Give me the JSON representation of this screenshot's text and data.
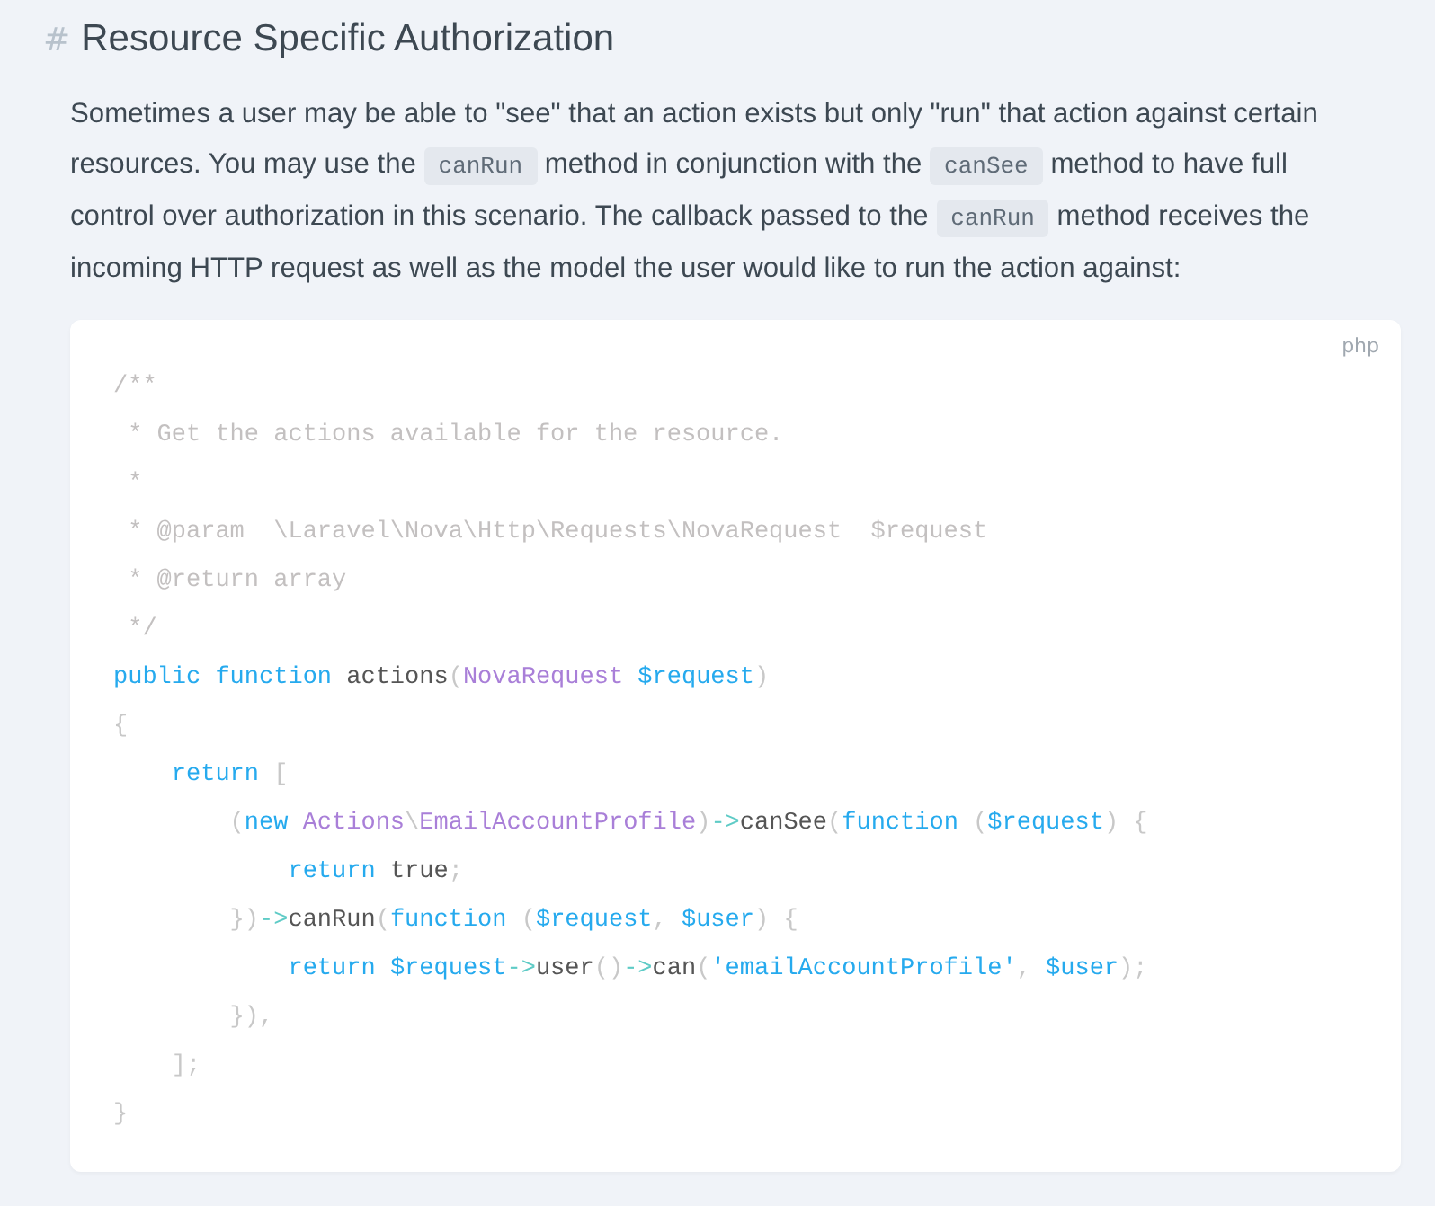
{
  "heading": {
    "mark": "#",
    "title": "Resource Specific Authorization"
  },
  "paragraph": [
    {
      "kind": "text",
      "text": "Sometimes a user may be able to \"see\" that an action exists but only \"run\" that action against certain resources. You may use the "
    },
    {
      "kind": "code",
      "text": "canRun"
    },
    {
      "kind": "text",
      "text": " method in conjunction with the "
    },
    {
      "kind": "code",
      "text": "canSee"
    },
    {
      "kind": "text",
      "text": " method to have full control over authorization in this scenario. The callback passed to the "
    },
    {
      "kind": "code",
      "text": "canRun"
    },
    {
      "kind": "text",
      "text": " method receives the incoming HTTP request as well as the model the user would like to run the action against:"
    }
  ],
  "code_block": {
    "language": "php",
    "lines": [
      [
        {
          "kind": "comment",
          "text": "/**"
        }
      ],
      [
        {
          "kind": "comment",
          "text": " * Get the actions available for the resource."
        }
      ],
      [
        {
          "kind": "comment",
          "text": " *"
        }
      ],
      [
        {
          "kind": "comment",
          "text": " * @param  \\Laravel\\Nova\\Http\\Requests\\NovaRequest  $request"
        }
      ],
      [
        {
          "kind": "comment",
          "text": " * @return array"
        }
      ],
      [
        {
          "kind": "comment",
          "text": " */"
        }
      ],
      [
        {
          "kind": "keyword",
          "text": "public function "
        },
        {
          "kind": "plain",
          "text": "actions"
        },
        {
          "kind": "punct",
          "text": "("
        },
        {
          "kind": "class",
          "text": "NovaRequest "
        },
        {
          "kind": "variable",
          "text": "$request"
        },
        {
          "kind": "punct",
          "text": ")"
        }
      ],
      [
        {
          "kind": "punct",
          "text": "{"
        }
      ],
      [
        {
          "kind": "keyword",
          "text": "    return "
        },
        {
          "kind": "punct",
          "text": "["
        }
      ],
      [
        {
          "kind": "punct",
          "text": "        ("
        },
        {
          "kind": "keyword",
          "text": "new "
        },
        {
          "kind": "class",
          "text": "Actions"
        },
        {
          "kind": "punct",
          "text": "\\"
        },
        {
          "kind": "class",
          "text": "EmailAccountProfile"
        },
        {
          "kind": "punct",
          "text": ")"
        },
        {
          "kind": "operator",
          "text": "->"
        },
        {
          "kind": "plain",
          "text": "canSee"
        },
        {
          "kind": "punct",
          "text": "("
        },
        {
          "kind": "keyword",
          "text": "function "
        },
        {
          "kind": "punct",
          "text": "("
        },
        {
          "kind": "variable",
          "text": "$request"
        },
        {
          "kind": "punct",
          "text": ") {"
        }
      ],
      [
        {
          "kind": "keyword",
          "text": "            return "
        },
        {
          "kind": "plain",
          "text": "true"
        },
        {
          "kind": "punct",
          "text": ";"
        }
      ],
      [
        {
          "kind": "punct",
          "text": "        })"
        },
        {
          "kind": "operator",
          "text": "->"
        },
        {
          "kind": "plain",
          "text": "canRun"
        },
        {
          "kind": "punct",
          "text": "("
        },
        {
          "kind": "keyword",
          "text": "function "
        },
        {
          "kind": "punct",
          "text": "("
        },
        {
          "kind": "variable",
          "text": "$request"
        },
        {
          "kind": "punct",
          "text": ", "
        },
        {
          "kind": "variable",
          "text": "$user"
        },
        {
          "kind": "punct",
          "text": ") {"
        }
      ],
      [
        {
          "kind": "keyword",
          "text": "            return "
        },
        {
          "kind": "variable",
          "text": "$request"
        },
        {
          "kind": "operator",
          "text": "->"
        },
        {
          "kind": "plain",
          "text": "user"
        },
        {
          "kind": "punct",
          "text": "()"
        },
        {
          "kind": "operator",
          "text": "->"
        },
        {
          "kind": "plain",
          "text": "can"
        },
        {
          "kind": "punct",
          "text": "("
        },
        {
          "kind": "string",
          "text": "'emailAccountProfile'"
        },
        {
          "kind": "punct",
          "text": ", "
        },
        {
          "kind": "variable",
          "text": "$user"
        },
        {
          "kind": "punct",
          "text": ");"
        }
      ],
      [
        {
          "kind": "punct",
          "text": "        }),"
        }
      ],
      [
        {
          "kind": "punct",
          "text": "    ];"
        }
      ],
      [
        {
          "kind": "punct",
          "text": "}"
        }
      ]
    ]
  }
}
